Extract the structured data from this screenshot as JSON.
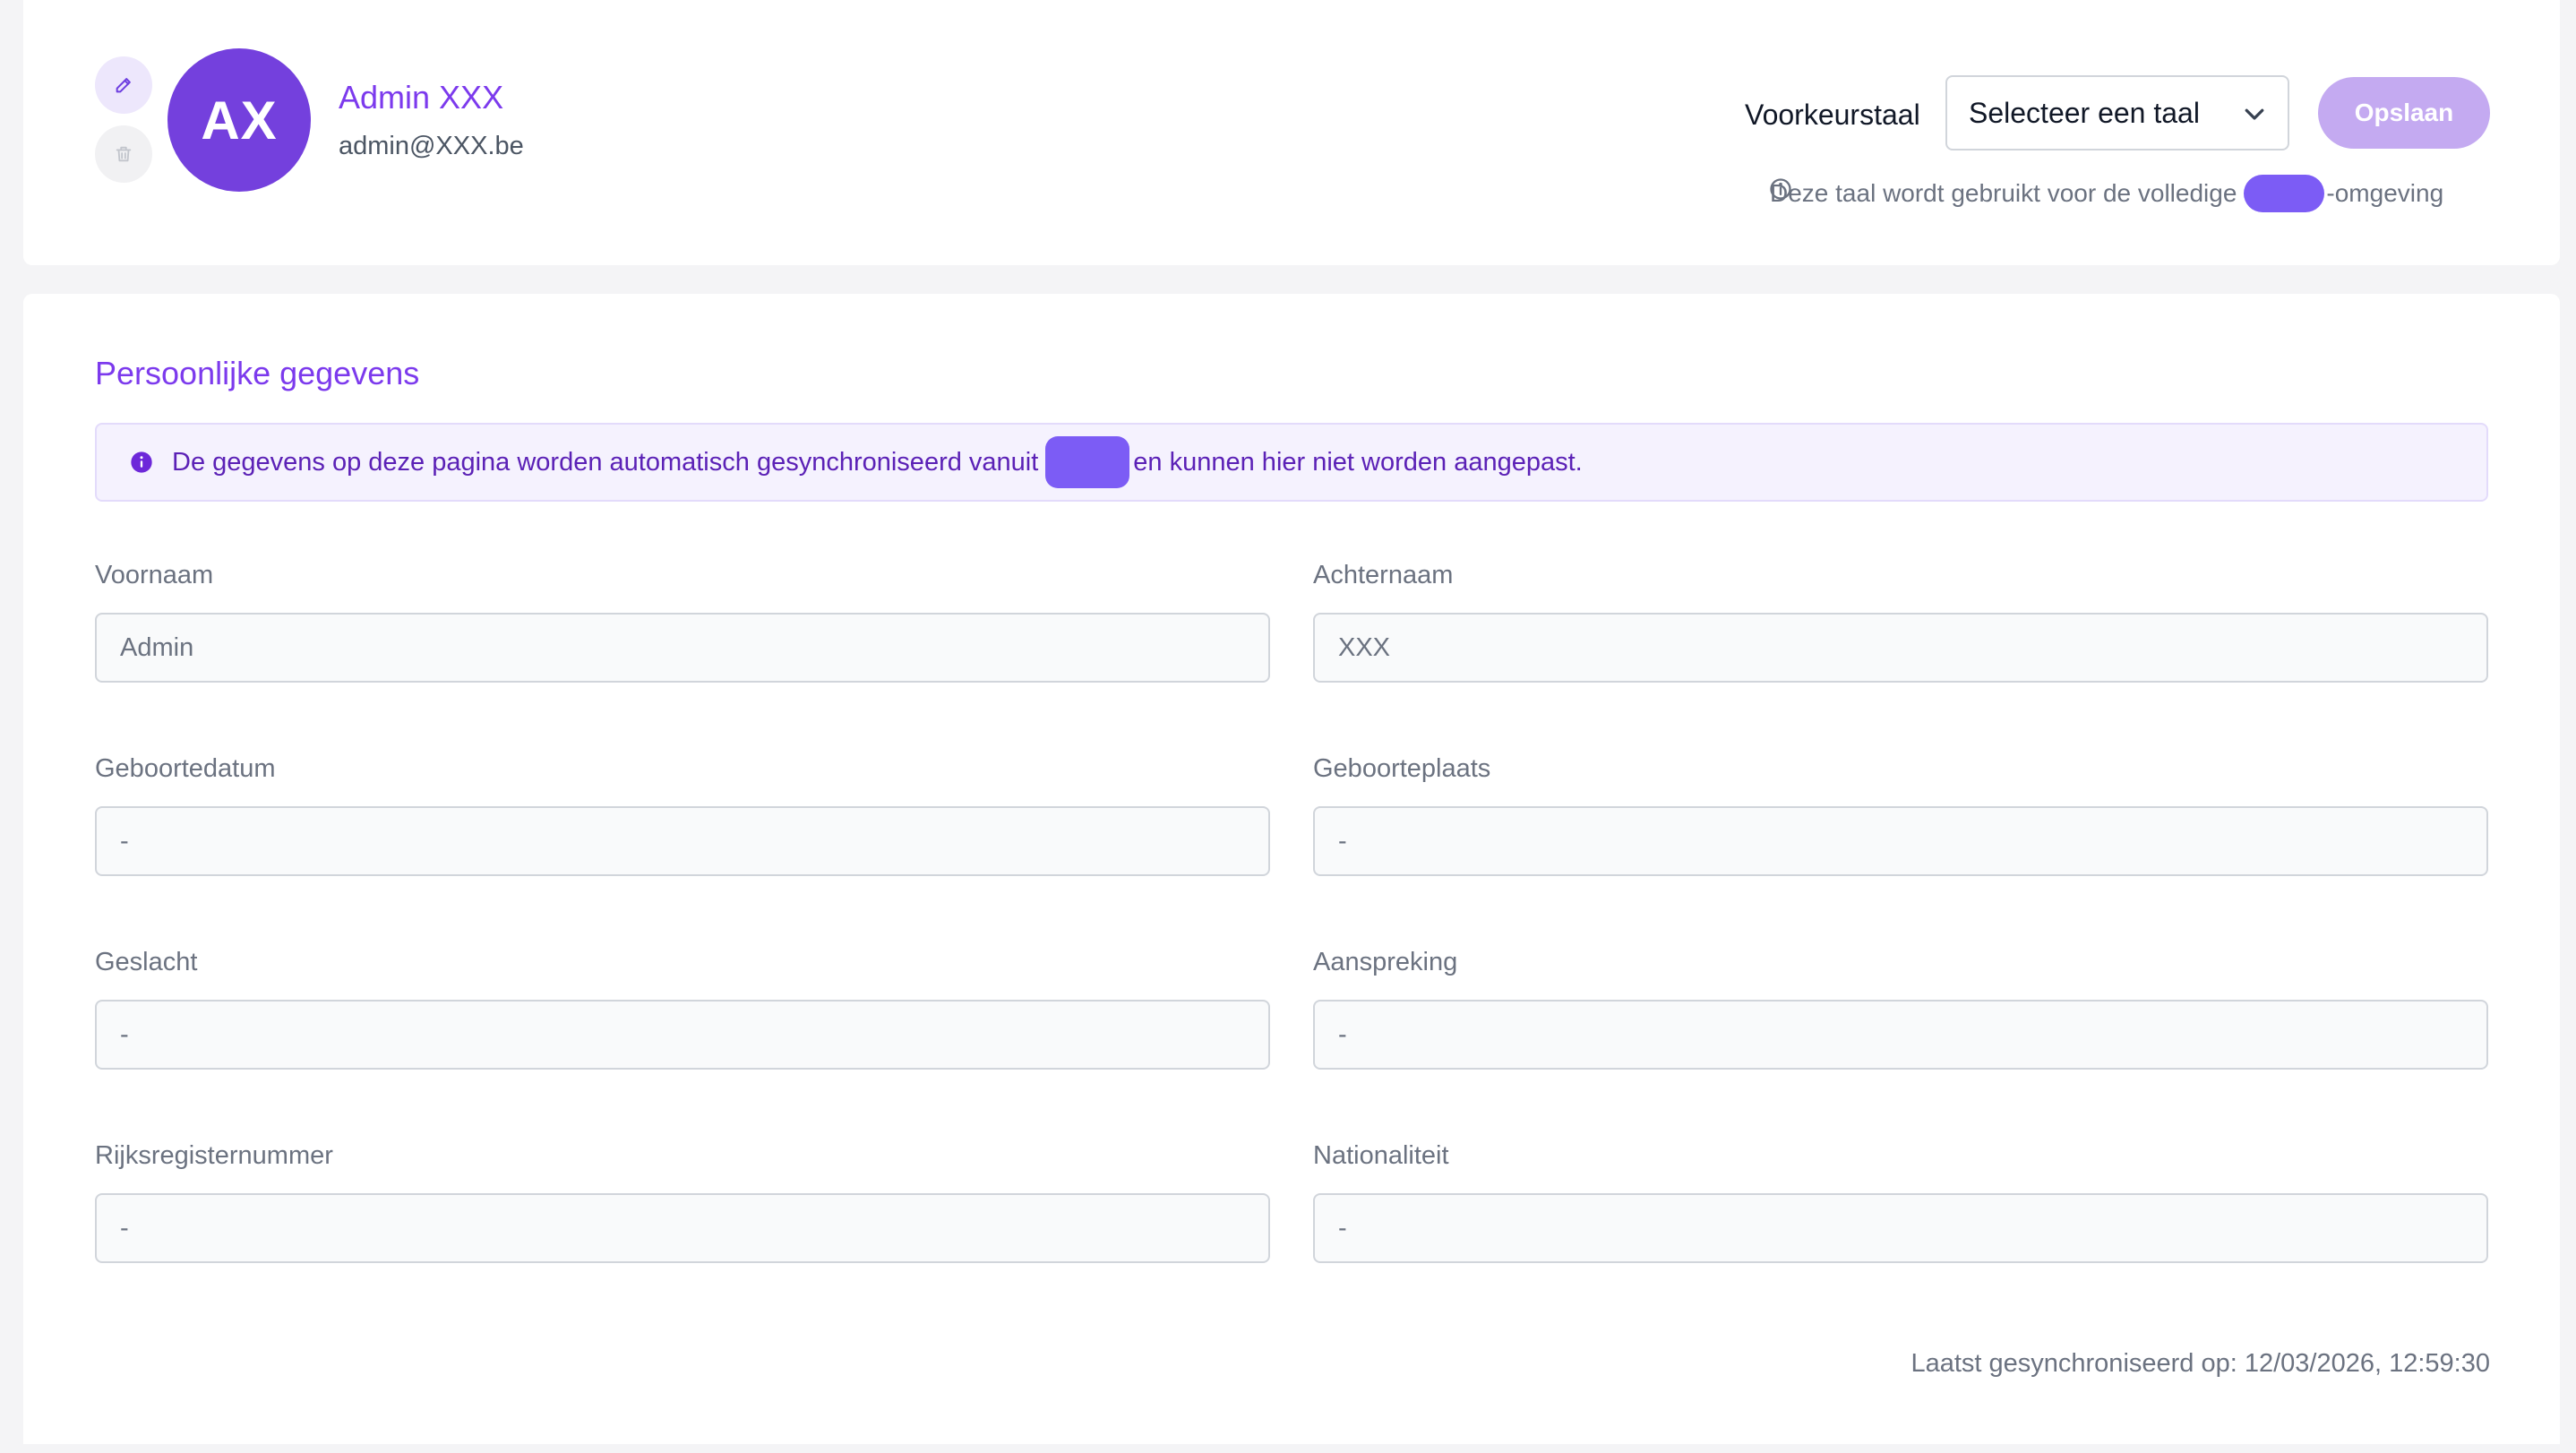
{
  "profile": {
    "initials": "AX",
    "name": "Admin XXX",
    "email": "admin@XXX.be"
  },
  "language": {
    "label": "Voorkeurstaal",
    "select_value": "Selecteer een taal",
    "save_label": "Opslaan",
    "hint_before": "Deze taal wordt gebruikt voor de volledige",
    "hint_after": "-omgeving"
  },
  "personal": {
    "title": "Persoonlijke gegevens",
    "notice_before": "De gegevens op deze pagina worden automatisch gesynchroniseerd vanuit",
    "notice_after": "en kunnen hier niet worden aangepast.",
    "fields": [
      {
        "label": "Voornaam",
        "value": "Admin"
      },
      {
        "label": "Achternaam",
        "value": "XXX"
      },
      {
        "label": "Geboortedatum",
        "value": "-"
      },
      {
        "label": "Geboorteplaats",
        "value": "-"
      },
      {
        "label": "Geslacht",
        "value": "-"
      },
      {
        "label": "Aanspreking",
        "value": "-"
      },
      {
        "label": "Rijksregisternummer",
        "value": "-"
      },
      {
        "label": "Nationaliteit",
        "value": "-"
      }
    ],
    "last_synced": "Laatst gesynchroniseerd op: 12/03/2026, 12:59:30"
  },
  "colors": {
    "accent": "#7c3aed",
    "avatar": "#7440dd",
    "save_disabled": "#c4aaf1",
    "notice_bg": "#f5f2fe"
  }
}
